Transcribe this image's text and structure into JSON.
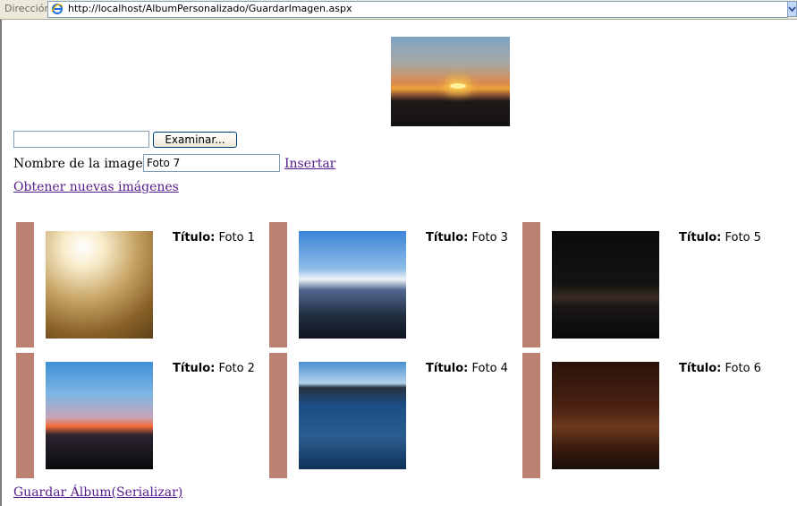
{
  "address_bar": {
    "label": "Dirección",
    "url": "http://localhost/AlbumPersonalizado/GuardarImagen.aspx"
  },
  "form": {
    "browse_label": "Examinar...",
    "file_value": "",
    "name_label": "Nombre de la imagen",
    "name_value": "Foto 7",
    "insert_link": "Insertar",
    "obtain_link": "Obtener nuevas imágenes",
    "save_link": "Guardar Álbum(Serializar)"
  },
  "gallery": {
    "title_prefix": "Título:",
    "items": [
      {
        "title": "Foto 1",
        "image": "sunlit-grass-field"
      },
      {
        "title": "Foto 2",
        "image": "sunset-over-mountains"
      },
      {
        "title": "Foto 3",
        "image": "sun-over-mountain-ridge"
      },
      {
        "title": "Foto 4",
        "image": "sun-over-lake"
      },
      {
        "title": "Foto 5",
        "image": "city-river-night"
      },
      {
        "title": "Foto 6",
        "image": "bridge-at-night"
      }
    ]
  },
  "colors": {
    "card_bar": "#bc8170",
    "link": "#551a8b"
  }
}
